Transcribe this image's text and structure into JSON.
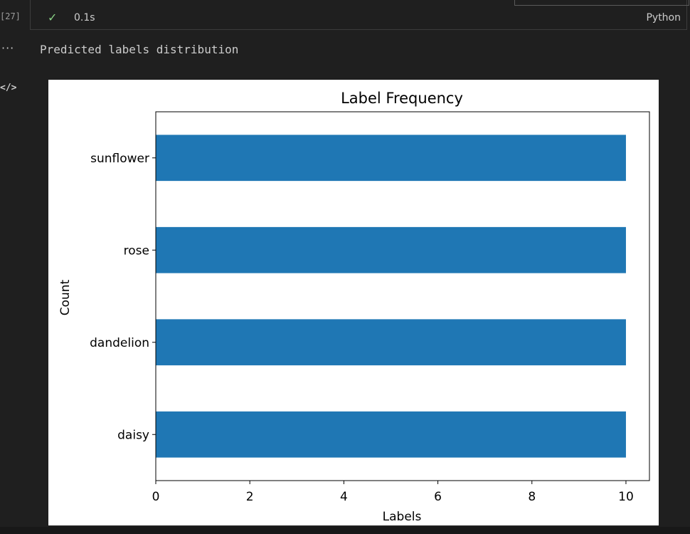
{
  "cell": {
    "execution_count": "[27]",
    "duration": "0.1s",
    "language": "Python"
  },
  "output": {
    "text": "Predicted labels distribution"
  },
  "icons": {
    "check": "check-icon",
    "more": "ellipsis-icon",
    "code": "code-icon"
  },
  "colors": {
    "bar": "#1f77b4",
    "check": "#89d185",
    "background": "#1f1f1f"
  },
  "chart_data": {
    "type": "bar",
    "orientation": "horizontal",
    "title": "Label Frequency",
    "xlabel": "Labels",
    "ylabel": "Count",
    "categories": [
      "daisy",
      "dandelion",
      "rose",
      "sunflower"
    ],
    "values": [
      10,
      10,
      10,
      10
    ],
    "xlim": [
      0,
      10.5
    ],
    "xticks": [
      0,
      2,
      4,
      6,
      8,
      10
    ],
    "grid": false,
    "legend": "none"
  }
}
